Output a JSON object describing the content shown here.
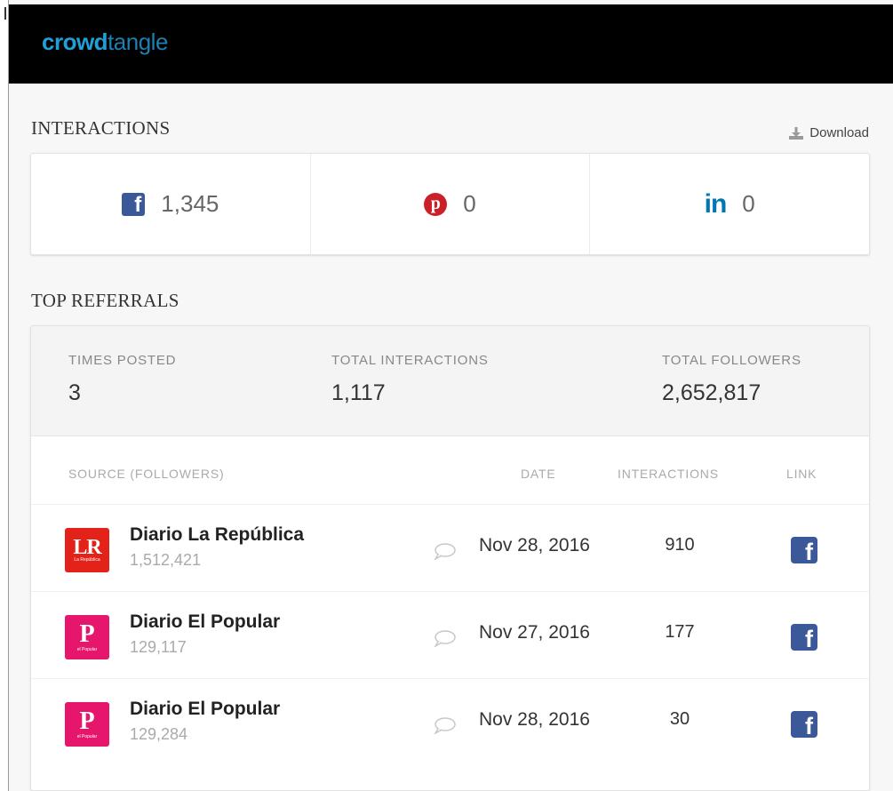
{
  "brand": {
    "logo_part1": "crowd",
    "logo_part2": "tangle"
  },
  "interactions": {
    "title": "INTERACTIONS",
    "download_label": "Download",
    "facebook": {
      "icon": "facebook-icon",
      "count": "1,345"
    },
    "pinterest": {
      "icon": "pinterest-icon",
      "count": "0"
    },
    "linkedin": {
      "icon": "linkedin-icon",
      "label": "in",
      "count": "0"
    }
  },
  "top_referrals": {
    "title": "TOP REFERRALS",
    "summary": {
      "times_posted_label": "TIMES POSTED",
      "times_posted": "3",
      "total_interactions_label": "TOTAL INTERACTIONS",
      "total_interactions": "1,117",
      "total_followers_label": "TOTAL FOLLOWERS",
      "total_followers": "2,652,817"
    },
    "columns": {
      "source": "SOURCE (FOLLOWERS)",
      "date": "DATE",
      "interactions": "INTERACTIONS",
      "link": "LINK"
    },
    "rows": [
      {
        "name": "Diario La República",
        "followers": "1,512,421",
        "logo_text": "LR",
        "logo_sub": "La República",
        "date": "Nov 28, 2016",
        "interactions": "910"
      },
      {
        "name": "Diario El Popular",
        "followers": "129,117",
        "logo_text": "P",
        "logo_sub": "el Popular",
        "date": "Nov 27, 2016",
        "interactions": "177"
      },
      {
        "name": "Diario El Popular",
        "followers": "129,284",
        "logo_text": "P",
        "logo_sub": "el Popular",
        "date": "Nov 28, 2016",
        "interactions": "30"
      }
    ]
  },
  "colors": {
    "facebook": "#3b5998",
    "pinterest": "#cb2027",
    "linkedin": "#0077b5",
    "logo_blue": "#1fa1d8",
    "lr_red": "#e32219",
    "popular_pink": "#e5166b"
  }
}
